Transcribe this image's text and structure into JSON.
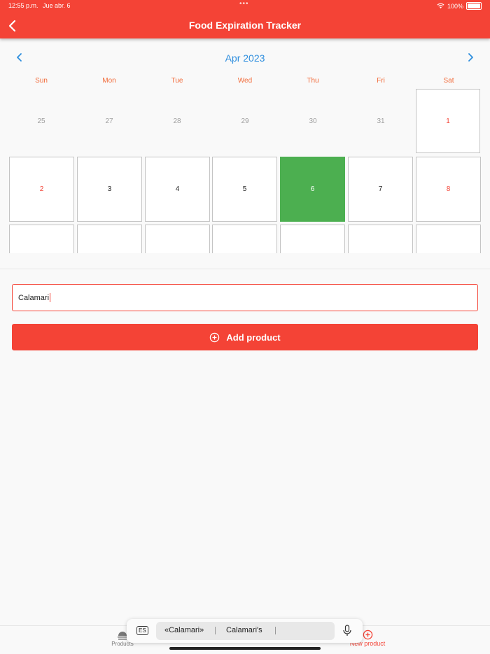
{
  "status_bar": {
    "time": "12:55 p.m.",
    "date": "Jue abr. 6",
    "battery": "100%"
  },
  "header": {
    "title": "Food Expiration Tracker"
  },
  "calendar": {
    "month_label": "Apr 2023",
    "weekdays": [
      "Sun",
      "Mon",
      "Tue",
      "Wed",
      "Thu",
      "Fri",
      "Sat"
    ],
    "rows": [
      [
        "25",
        "27",
        "28",
        "29",
        "30",
        "31",
        "1"
      ],
      [
        "2",
        "3",
        "4",
        "5",
        "6",
        "7",
        "8"
      ]
    ],
    "selected_day": "6",
    "colors": {
      "accent": "#f44336",
      "selected": "#4caf50",
      "month": "#2e8ede",
      "weekday": "#f26b3a"
    }
  },
  "form": {
    "product_name_value": "Calamari",
    "add_button_label": "Add product"
  },
  "tabbar": {
    "products_label": "Products",
    "new_product_label": "New product"
  },
  "keyboard_suggestions": {
    "language": "ES",
    "items": [
      "«Calamari»",
      "Calamari's"
    ]
  }
}
